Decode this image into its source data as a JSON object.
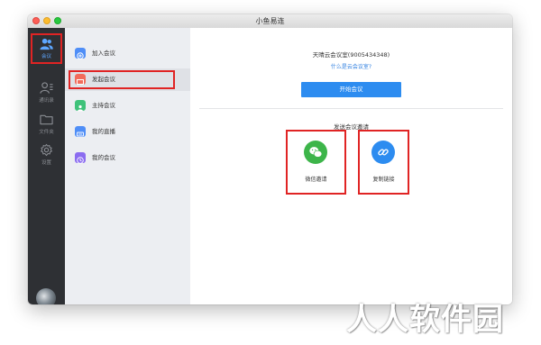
{
  "window": {
    "title": "小鱼易连"
  },
  "sidebar": {
    "items": [
      {
        "label": "会议",
        "icon": "users-icon"
      },
      {
        "label": "通讯录",
        "icon": "contacts-icon"
      },
      {
        "label": "文件夹",
        "icon": "folder-icon"
      },
      {
        "label": "设置",
        "icon": "gear-icon"
      }
    ],
    "active": "会议",
    "accent": "#5ea7ff"
  },
  "menu": {
    "items": [
      {
        "label": "加入会议",
        "icon": "plus-icon",
        "color": "#4f8ef7"
      },
      {
        "label": "发起会议",
        "icon": "video-icon",
        "color": "#f26b5b"
      },
      {
        "label": "主持会议",
        "icon": "host-icon",
        "color": "#3fc27a"
      },
      {
        "label": "我的直播",
        "icon": "live-icon",
        "color": "#4f8ef7"
      },
      {
        "label": "我的会议",
        "icon": "clock-icon",
        "color": "#8b6cf0"
      }
    ],
    "selected": "发起会议"
  },
  "main": {
    "room_name": "天晴云会议室(9005434348)",
    "room_help_link": "什么是云会议室?",
    "start_button": "开始会议",
    "invite_title": "发送会议邀请",
    "share": [
      {
        "label": "微信邀请",
        "icon": "wechat-icon",
        "color": "#3db54a"
      },
      {
        "label": "复制链接",
        "icon": "link-icon",
        "color": "#2d8cf0"
      }
    ]
  },
  "watermark": "人人软件园"
}
